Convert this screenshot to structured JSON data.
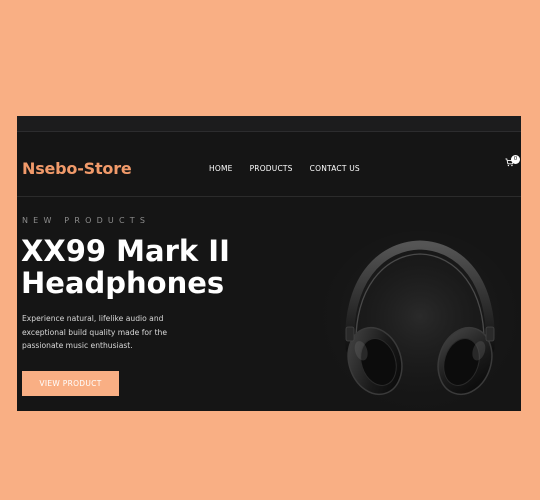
{
  "store": {
    "name": "Nsebo-Store"
  },
  "nav": {
    "items": [
      {
        "label": "HOME"
      },
      {
        "label": "PRODUCTS"
      },
      {
        "label": "CONTACT US"
      }
    ],
    "cart_count": "0"
  },
  "hero": {
    "eyebrow": "NEW PRODUCTS",
    "title_line1": "XX99 Mark II",
    "title_line2": "Headphones",
    "description": "Experience natural, lifelike audio and exceptional build quality made for the passionate music enthusiast.",
    "cta_label": "VIEW PRODUCT",
    "image_icon": "headphones-image"
  },
  "colors": {
    "background": "#f9af84",
    "panel": "#151515",
    "accent": "#f19a6a",
    "text": "#ffffff"
  }
}
